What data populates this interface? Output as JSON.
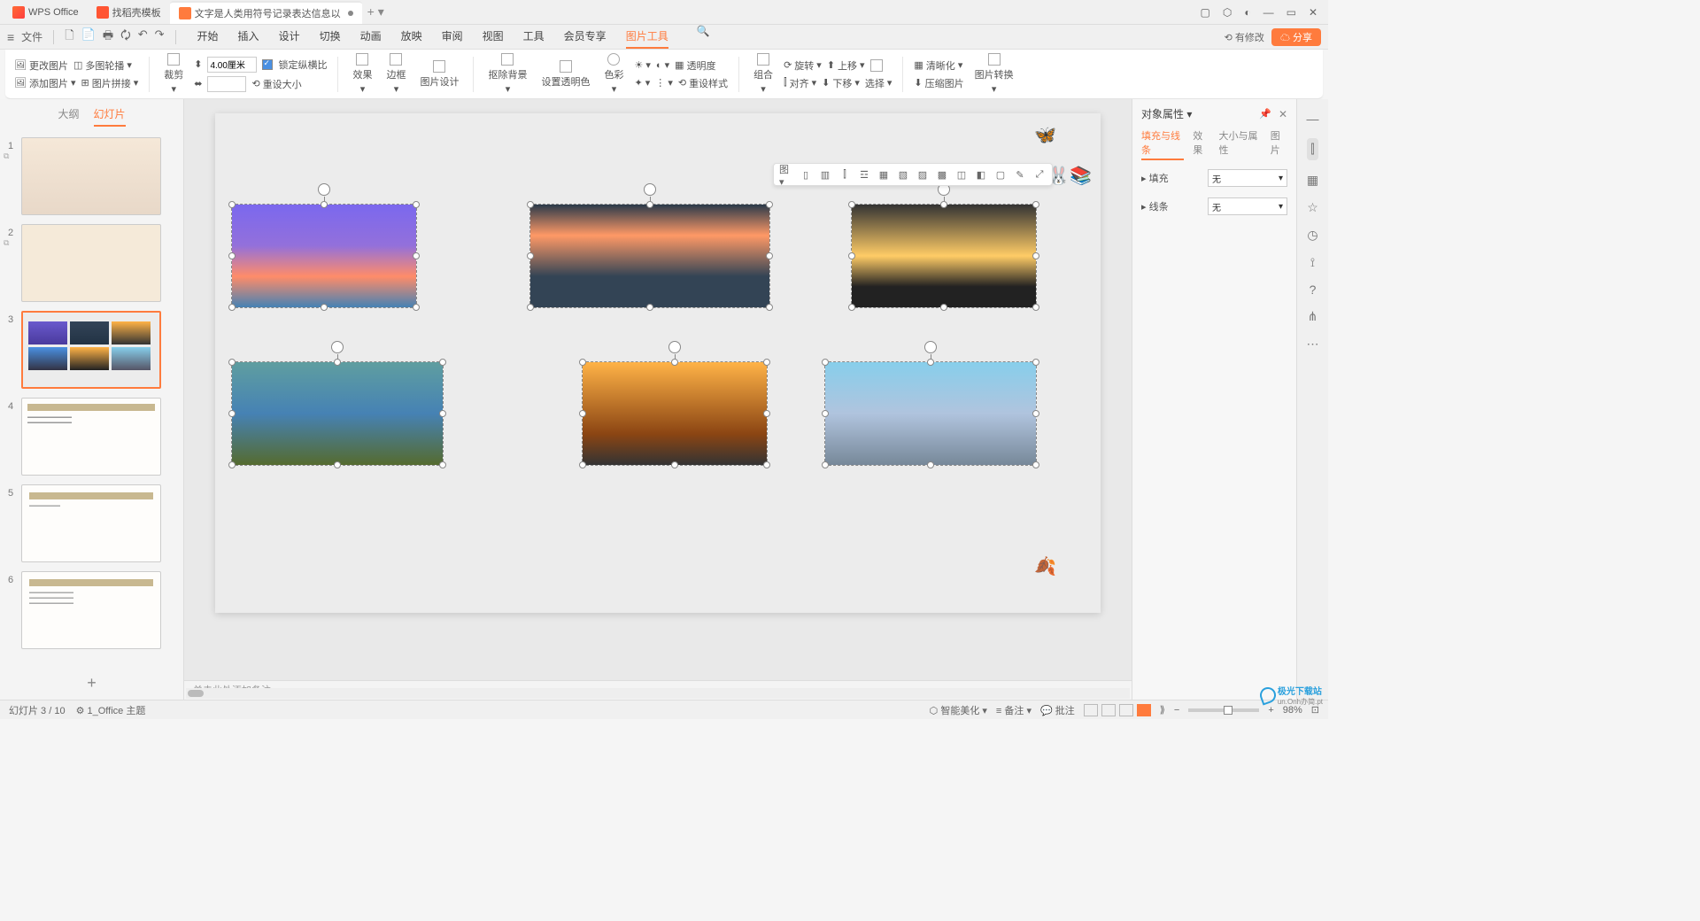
{
  "title_bar": {
    "tabs": [
      {
        "icon": "wps",
        "label": "WPS Office"
      },
      {
        "icon": "tpl",
        "label": "找稻壳模板"
      },
      {
        "icon": "ppt",
        "label": "文字是人类用符号记录表达信息以",
        "active": true,
        "modified": true
      }
    ],
    "add": "+",
    "win": [
      "▢",
      "⬡",
      "◐",
      "—",
      "▭",
      "✕"
    ]
  },
  "menu_bar": {
    "file": "文件",
    "qat": [
      "🗋",
      "📄",
      "🖶",
      "🗘",
      "↶",
      "↷"
    ],
    "tabs": [
      "开始",
      "插入",
      "设计",
      "切换",
      "动画",
      "放映",
      "审阅",
      "视图",
      "工具",
      "会员专享",
      "图片工具"
    ],
    "active_tab": "图片工具",
    "search": "🔍",
    "cloud": "⟲ 有修改",
    "share": "☁ 分享"
  },
  "ribbon": {
    "change_image": "更改图片",
    "multi_image_broadcast": "多图轮播",
    "add_image": "添加图片",
    "image_join": "图片拼接",
    "crop": "裁剪",
    "size_value": "4.00厘米",
    "lock_ratio": "锁定纵横比",
    "reset_size": "重设大小",
    "effect": "效果",
    "border": "边框",
    "image_design": "图片设计",
    "remove_bg": "抠除背景",
    "set_transparent": "设置透明色",
    "color": "色彩",
    "transparency": "透明度",
    "reset_style": "重设样式",
    "group": "组合",
    "rotate": "旋转",
    "align": "对齐",
    "up": "上移",
    "down": "下移",
    "select": "选择",
    "clarity": "清晰化",
    "compress": "压缩图片",
    "image_convert": "图片转换"
  },
  "slide_panel": {
    "tabs": [
      "大纲",
      "幻灯片"
    ],
    "active_tab": "幻灯片",
    "slides": [
      1,
      2,
      3,
      4,
      5,
      6
    ],
    "selected": 3,
    "add": "+"
  },
  "float_toolbar": [
    "图▾",
    "▯",
    "▥",
    "⫿",
    "☲",
    "▦",
    "▧",
    "▨",
    "▩",
    "◫",
    "◧",
    "▢",
    "✎",
    "⤢"
  ],
  "notes_placeholder": "单击此处添加备注",
  "right_panel": {
    "title": "对象属性",
    "tabs": [
      "填充与线条",
      "效果",
      "大小与属性",
      "图片"
    ],
    "active_tab": "填充与线条",
    "fill_label": "填充",
    "fill_value": "无",
    "line_label": "线条",
    "line_value": "无"
  },
  "right_strip": [
    "—",
    "⫿",
    "▦",
    "☆",
    "◷",
    "⟟",
    "?",
    "⋔",
    "⋯"
  ],
  "status": {
    "slide_info": "幻灯片 3 / 10",
    "theme": "1_Office 主题",
    "beautify": "智能美化",
    "notes": "备注",
    "comment": "批注",
    "zoom": "98%"
  },
  "watermark": {
    "text": "极光下载站",
    "sub": "un.Onh办简.pt"
  }
}
